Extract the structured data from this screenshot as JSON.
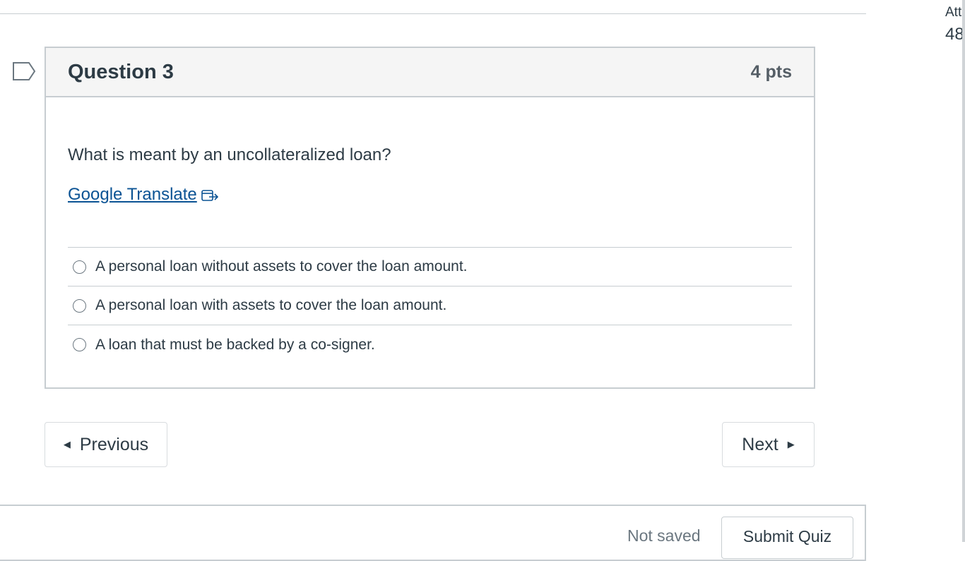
{
  "sidebar_info": {
    "label": "Att",
    "value": "48"
  },
  "question": {
    "title": "Question 3",
    "points": "4 pts",
    "text": "What is meant by an uncollateralized loan?",
    "translate_link": "Google Translate",
    "answers": [
      {
        "label": "A personal loan without assets to cover the loan amount."
      },
      {
        "label": "A personal loan with assets to cover the loan amount."
      },
      {
        "label": "A loan that must be backed by a co-signer."
      }
    ]
  },
  "navigation": {
    "previous_label": "Previous",
    "next_label": "Next"
  },
  "footer": {
    "status": "Not saved",
    "submit_label": "Submit Quiz"
  },
  "colors": {
    "link": "#0b5394",
    "text": "#2d3b45",
    "border": "#c7cdd1",
    "header_bg": "#f5f5f5"
  },
  "icons": {
    "flag": "flag-bookmark-icon",
    "external": "external-link-icon",
    "prev": "triangle-left-icon",
    "next": "triangle-right-icon"
  }
}
